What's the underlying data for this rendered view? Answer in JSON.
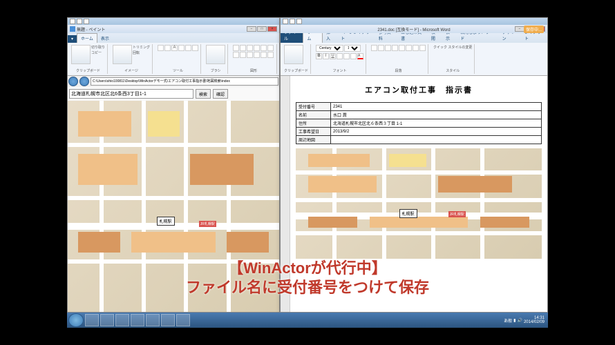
{
  "paint": {
    "title": "無題 - ペイント",
    "tabs": {
      "home": "ホーム",
      "view": "表示"
    },
    "groups": {
      "clipboard": "クリップボード",
      "image": "イメージ",
      "tools": "ツール",
      "brush": "ブラシ",
      "shapes": "図形"
    },
    "clipboard_paste": "貼り付け",
    "cut": "切り取り",
    "copy": "コピー",
    "trimming": "トリミング",
    "select": "選択",
    "rotate": "回転",
    "address": "C:\\Users\\shio100811\\Desktop\\WinActorデモ一式\\エアコン取付工事指示書\\地図検索\\index",
    "search_value": "北海道札幌市北区北6条西3丁目1-1",
    "search_btn": "検索",
    "confirm_btn": "確認"
  },
  "word": {
    "title": "2341.doc [互換モード] - Microsoft Word",
    "saving": "保存中...",
    "tabs": {
      "file": "ファイル",
      "home": "ホーム",
      "insert": "挿入",
      "layout": "ページレイアウト",
      "ref": "参考資料",
      "mail": "差し込み文書",
      "review": "校閲",
      "view": "表示",
      "addin": "活用しよう！ワード",
      "design": "デザイン",
      "tlayout": "レイアウト"
    },
    "font": "Century",
    "size": "10.5",
    "groups": {
      "clipboard": "クリップボード",
      "font": "フォント",
      "para": "段落",
      "style": "スタイル",
      "quick": "クイック スタイルの変更"
    },
    "paste": "貼り付け",
    "doc": {
      "title": "エアコン取付工事　指示書",
      "rows": [
        {
          "label": "受付番号",
          "value": "2341"
        },
        {
          "label": "名前",
          "value": "水口 潤"
        },
        {
          "label": "住所",
          "value": "北海道札幌市北区北６条西３丁目 1-1"
        },
        {
          "label": "工事希望日",
          "value": "2013/9/2"
        },
        {
          "label": "周辺地図",
          "value": ""
        }
      ]
    }
  },
  "map": {
    "station": "札幌駅",
    "jr": "JR札幌駅"
  },
  "overlay": {
    "line1": "【WinActorが代行中】",
    "line2": "ファイル名に受付番号をつけて保存"
  },
  "taskbar": {
    "ime": "あ般",
    "time": "14:31",
    "date": "2014/02/09"
  }
}
